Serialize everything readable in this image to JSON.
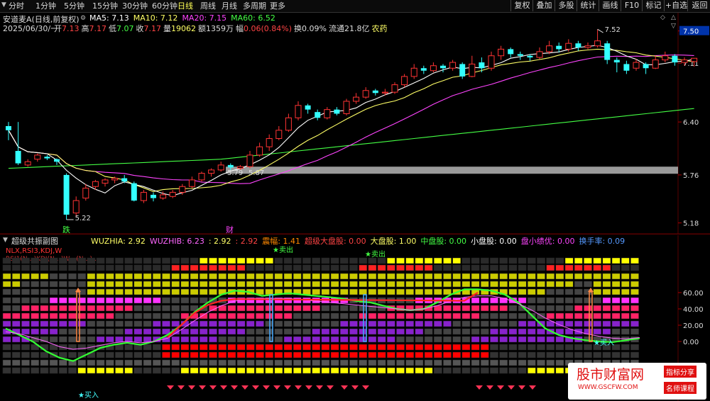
{
  "toolbar": {
    "tabs": [
      {
        "label": "分时",
        "active": false
      },
      {
        "label": "1分钟",
        "active": false
      },
      {
        "label": "5分钟",
        "active": false
      },
      {
        "label": "15分钟",
        "active": false
      },
      {
        "label": "30分钟",
        "active": false
      },
      {
        "label": "60分钟",
        "active": false
      },
      {
        "label": "日线",
        "active": true
      },
      {
        "label": "周线",
        "active": false
      },
      {
        "label": "月线",
        "active": false
      },
      {
        "label": "多周期",
        "active": false
      },
      {
        "label": "更多",
        "active": false
      }
    ],
    "right_buttons": [
      "复权",
      "叠加",
      "多股",
      "统计",
      "画线",
      "F10",
      "标记",
      "+自选",
      "返回"
    ]
  },
  "stock": {
    "title": "安道麦A(日线,前复权)",
    "ma": [
      {
        "label": "MA5: 7.13",
        "color": "#ffffff"
      },
      {
        "label": "MA10: 7.12",
        "color": "#ffff66"
      },
      {
        "label": "MA20: 7.15",
        "color": "#ff44ff"
      },
      {
        "label": "MA60: 6.52",
        "color": "#44ff44"
      }
    ],
    "date": "2025/06/30/一",
    "quote": [
      {
        "label": "开",
        "value": "7.13",
        "color": "#ff4444"
      },
      {
        "label": "高",
        "value": "7.17",
        "color": "#ff4444"
      },
      {
        "label": "低",
        "value": "7.07",
        "color": "#44ff44"
      },
      {
        "label": "收",
        "value": "7.17",
        "color": "#ff4444"
      },
      {
        "label": "量",
        "value": "19062",
        "color": "#ffff66"
      },
      {
        "label": "额",
        "value": "1359万",
        "color": "#dddddd"
      },
      {
        "label": "幅",
        "value": "0.06(0.84%)",
        "color": "#ff4444"
      },
      {
        "label": "换",
        "value": "0.09%",
        "color": "#dddddd"
      },
      {
        "label": "流通",
        "value": "21.8亿",
        "color": "#dddddd"
      },
      {
        "label": "",
        "value": "农药",
        "color": "#ffff66"
      }
    ],
    "price_axis": [
      "7.50",
      "7.11",
      "6.40",
      "5.76",
      "5.18"
    ],
    "current_price": "7.50",
    "annotations": {
      "high": "7.52",
      "low": "5.22",
      "mid1": "5.79",
      "mid2": "5.87",
      "fall": "跌",
      "cai": "财"
    }
  },
  "indicator": {
    "name": "超级共振副图",
    "values": [
      {
        "label": "WUZHIA: 2.92",
        "color": "#ffff66"
      },
      {
        "label": "WUZHIB: 6.23",
        "color": "#ff66ff"
      },
      {
        "label": ": 2.92",
        "color": "#ffff66"
      },
      {
        "label": ": 2.92",
        "color": "#ff4444"
      },
      {
        "label": "震幅: 1.41",
        "color": "#ff8800"
      },
      {
        "label": "超级大盘股: 0.00",
        "color": "#ff4444"
      },
      {
        "label": "大盘股: 1.00",
        "color": "#ffff66"
      },
      {
        "label": "中盘股: 0.00",
        "color": "#44ff44"
      },
      {
        "label": "小盘股: 0.00",
        "color": "#ffffff"
      },
      {
        "label": "盘小绩优: 0.00",
        "color": "#ff44ff"
      },
      {
        "label": "换手率: 0.09",
        "color": "#5599ff"
      }
    ],
    "legend_line1": "NLX,RSI3,KDJ,W",
    "legend_line2": "RSI1(N…)KDJ(N…)W…(N…)…",
    "axis": [
      "60.00",
      "40.00",
      "20.00",
      "0.00"
    ],
    "signals": {
      "buy": "买入",
      "sell": "卖出"
    }
  },
  "watermark": {
    "main": "股市财富网",
    "url": "WWW.GSCFW.COM",
    "tag1": "指标分享",
    "tag2": "名师课程"
  },
  "colors": {
    "up": "#ff3333",
    "down": "#33ffff",
    "ma5": "#ffffff",
    "ma10": "#ffff66",
    "ma20": "#ff44ff",
    "ma60": "#44ff44"
  },
  "chart_data": {
    "type": "candlestick",
    "price_range": [
      5.1,
      7.6
    ],
    "candles": [
      [
        6.35,
        6.3,
        6.4,
        6.18
      ],
      [
        6.05,
        5.9,
        6.4,
        5.88
      ],
      [
        5.88,
        5.92,
        5.95,
        5.86
      ],
      [
        5.95,
        6.0,
        6.02,
        5.92
      ],
      [
        5.98,
        5.96,
        6.0,
        5.94
      ],
      [
        5.95,
        5.92,
        5.96,
        5.88
      ],
      [
        5.76,
        5.28,
        5.78,
        5.22
      ],
      [
        5.3,
        5.45,
        5.5,
        5.25
      ],
      [
        5.48,
        5.6,
        5.65,
        5.45
      ],
      [
        5.62,
        5.68,
        5.7,
        5.58
      ],
      [
        5.66,
        5.7,
        5.72,
        5.62
      ],
      [
        5.7,
        5.72,
        5.74,
        5.66
      ],
      [
        5.72,
        5.68,
        5.76,
        5.66
      ],
      [
        5.66,
        5.45,
        5.68,
        5.44
      ],
      [
        5.45,
        5.55,
        5.58,
        5.42
      ],
      [
        5.52,
        5.48,
        5.55,
        5.44
      ],
      [
        5.48,
        5.52,
        5.56,
        5.46
      ],
      [
        5.5,
        5.55,
        5.58,
        5.48
      ],
      [
        5.55,
        5.62,
        5.65,
        5.52
      ],
      [
        5.62,
        5.7,
        5.74,
        5.6
      ],
      [
        5.7,
        5.78,
        5.8,
        5.68
      ],
      [
        5.78,
        5.82,
        5.84,
        5.74
      ],
      [
        5.82,
        5.88,
        5.92,
        5.8
      ],
      [
        5.88,
        5.85,
        5.9,
        5.82
      ],
      [
        5.84,
        5.86,
        5.88,
        5.82
      ],
      [
        5.86,
        6.0,
        6.05,
        5.84
      ],
      [
        6.0,
        6.1,
        6.15,
        5.98
      ],
      [
        6.1,
        6.2,
        6.25,
        6.05
      ],
      [
        6.2,
        6.3,
        6.35,
        6.18
      ],
      [
        6.3,
        6.45,
        6.5,
        6.28
      ],
      [
        6.45,
        6.6,
        6.65,
        6.42
      ],
      [
        6.6,
        6.55,
        6.62,
        6.5
      ],
      [
        6.52,
        6.45,
        6.55,
        6.42
      ],
      [
        6.45,
        6.55,
        6.58,
        6.43
      ],
      [
        6.55,
        6.5,
        6.58,
        6.48
      ],
      [
        6.5,
        6.65,
        6.68,
        6.48
      ],
      [
        6.65,
        6.7,
        6.75,
        6.62
      ],
      [
        6.7,
        6.78,
        6.82,
        6.68
      ],
      [
        6.78,
        6.75,
        6.8,
        6.72
      ],
      [
        6.75,
        6.76,
        6.8,
        6.72
      ],
      [
        6.76,
        6.85,
        6.88,
        6.74
      ],
      [
        6.85,
        6.95,
        6.98,
        6.82
      ],
      [
        6.95,
        7.05,
        7.1,
        6.92
      ],
      [
        7.05,
        7.02,
        7.08,
        6.98
      ],
      [
        7.02,
        7.08,
        7.12,
        7.0
      ],
      [
        7.08,
        7.05,
        7.1,
        7.0
      ],
      [
        7.05,
        7.12,
        7.15,
        7.02
      ],
      [
        7.1,
        6.95,
        7.12,
        6.92
      ],
      [
        6.95,
        7.1,
        7.2,
        6.94
      ],
      [
        7.12,
        7.05,
        7.18,
        7.0
      ],
      [
        7.05,
        7.2,
        7.25,
        7.02
      ],
      [
        7.2,
        7.28,
        7.32,
        7.15
      ],
      [
        7.28,
        7.22,
        7.3,
        7.18
      ],
      [
        7.22,
        7.2,
        7.25,
        7.15
      ],
      [
        7.2,
        7.18,
        7.22,
        7.14
      ],
      [
        7.18,
        7.25,
        7.3,
        7.16
      ],
      [
        7.25,
        7.32,
        7.38,
        7.22
      ],
      [
        7.32,
        7.28,
        7.36,
        7.24
      ],
      [
        7.28,
        7.35,
        7.4,
        7.25
      ],
      [
        7.35,
        7.3,
        7.38,
        7.26
      ],
      [
        7.3,
        7.32,
        7.36,
        7.28
      ],
      [
        7.32,
        7.38,
        7.52,
        7.3
      ],
      [
        7.35,
        7.15,
        7.38,
        7.1
      ],
      [
        7.15,
        7.12,
        7.18,
        7.0
      ],
      [
        7.1,
        7.02,
        7.14,
        6.98
      ],
      [
        7.05,
        7.12,
        7.16,
        7.02
      ],
      [
        7.1,
        7.05,
        7.12,
        6.98
      ],
      [
        7.05,
        7.15,
        7.2,
        7.04
      ],
      [
        7.15,
        7.2,
        7.25,
        7.12
      ],
      [
        7.2,
        7.12,
        7.22,
        7.08
      ],
      [
        7.12,
        7.15,
        7.18,
        7.08
      ],
      [
        7.13,
        7.17,
        7.17,
        7.07
      ]
    ]
  }
}
